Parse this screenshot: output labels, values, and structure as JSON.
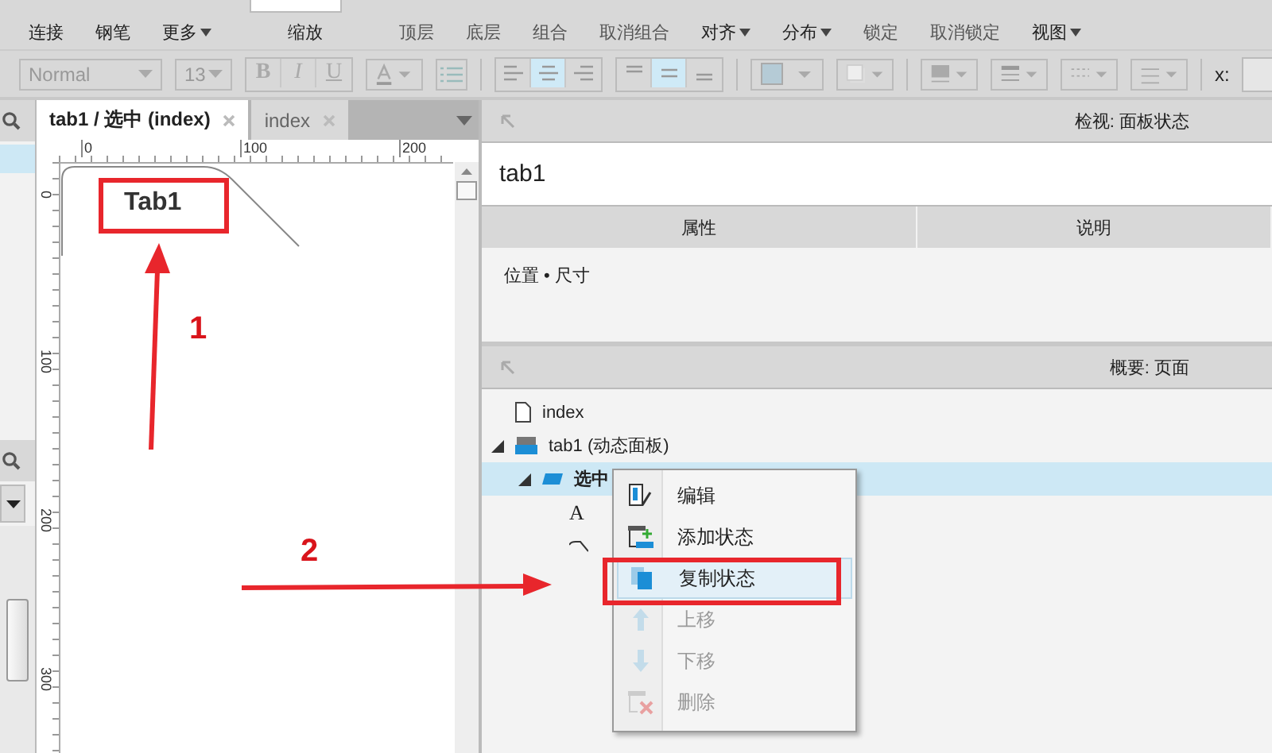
{
  "toolbar": {
    "buttons": [
      {
        "label": "连接",
        "has_menu": false,
        "disabled": false
      },
      {
        "label": "钢笔",
        "has_menu": false,
        "disabled": false
      },
      {
        "label": "更多",
        "has_menu": true,
        "disabled": false
      },
      {
        "label": "缩放",
        "has_menu": false,
        "disabled": false,
        "kind": "zoom"
      },
      {
        "label": "顶层",
        "has_menu": false,
        "disabled": true
      },
      {
        "label": "底层",
        "has_menu": false,
        "disabled": true
      },
      {
        "label": "组合",
        "has_menu": false,
        "disabled": true
      },
      {
        "label": "取消组合",
        "has_menu": false,
        "disabled": true
      },
      {
        "label": "对齐",
        "has_menu": true,
        "disabled": false
      },
      {
        "label": "分布",
        "has_menu": true,
        "disabled": false
      },
      {
        "label": "锁定",
        "has_menu": false,
        "disabled": true
      },
      {
        "label": "取消锁定",
        "has_menu": false,
        "disabled": true
      },
      {
        "label": "视图",
        "has_menu": true,
        "disabled": false
      }
    ]
  },
  "format_bar": {
    "font_style": "Normal",
    "font_size": "13",
    "text_styles": [
      "B",
      "I",
      "U"
    ],
    "text_align": [
      {
        "selected": false
      },
      {
        "selected": true
      },
      {
        "selected": false
      }
    ],
    "vertical_align": [
      {
        "selected": false
      },
      {
        "selected": true
      },
      {
        "selected": false
      }
    ],
    "x_label": "x:"
  },
  "document_tabs": [
    {
      "label": "tab1 / 选中 (index)",
      "selected": true
    },
    {
      "label": "index",
      "selected": false
    }
  ],
  "rulers": {
    "horizontal": [
      "0",
      "100",
      "200"
    ],
    "vertical": [
      "0",
      "100",
      "200",
      "300"
    ]
  },
  "canvas": {
    "tab_label": "Tab1"
  },
  "inspector": {
    "title": "检视: 面板状态",
    "name": "tab1",
    "columns": [
      "属性",
      "说明"
    ],
    "section": "位置 • 尺寸"
  },
  "outline": {
    "title": "概要: 页面",
    "tree": [
      {
        "label": "index",
        "kind": "page",
        "selected": false
      },
      {
        "label": "tab1 (动态面板)",
        "kind": "panel",
        "expanded": true,
        "selected": false,
        "children": [
          {
            "label": "选中",
            "kind": "state",
            "expanded": true,
            "selected": true,
            "children": [
              {
                "kind": "text",
                "icon": "A",
                "selected": false
              },
              {
                "kind": "line",
                "selected": false
              }
            ]
          }
        ]
      }
    ]
  },
  "context_menu": [
    {
      "label": "编辑",
      "kind": "edit",
      "disabled": false,
      "selected": false
    },
    {
      "label": "添加状态",
      "kind": "add",
      "disabled": false,
      "selected": false
    },
    {
      "label": "复制状态",
      "kind": "copy",
      "disabled": false,
      "selected": true
    },
    {
      "label": "上移",
      "kind": "up",
      "disabled": true,
      "selected": false
    },
    {
      "label": "下移",
      "kind": "down",
      "disabled": true,
      "selected": false
    },
    {
      "label": "删除",
      "kind": "delete",
      "disabled": true,
      "selected": false
    }
  ],
  "annotations": [
    {
      "label": "1"
    },
    {
      "label": "2"
    }
  ]
}
